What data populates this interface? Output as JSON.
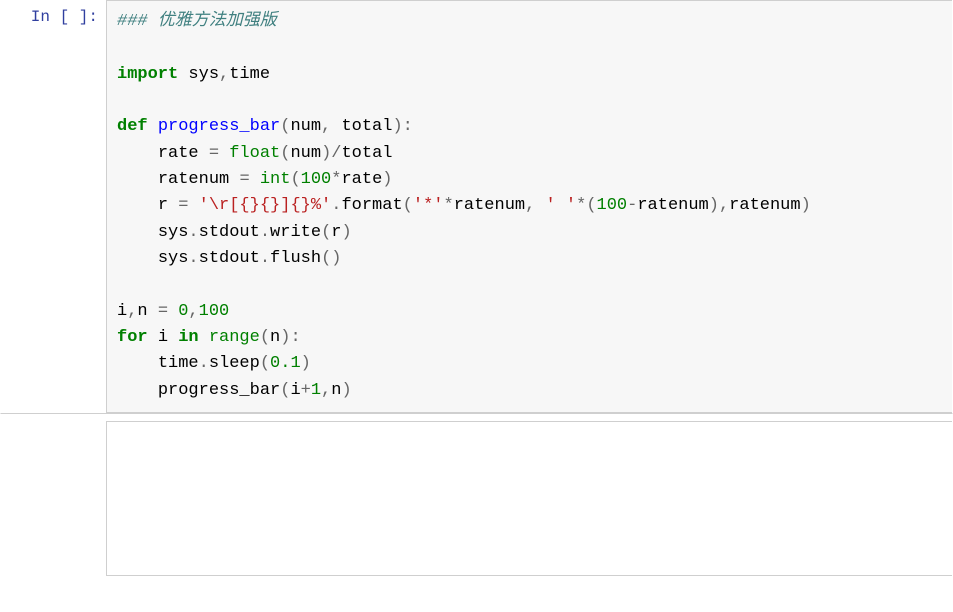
{
  "cell1": {
    "prompt": "In [ ]:",
    "code": {
      "comment": "### 优雅方法加强版",
      "kw_import": "import",
      "mod_sys": "sys",
      "mod_time": "time",
      "kw_def": "def",
      "fn_progress_bar": "progress_bar",
      "param_num": "num",
      "param_total": "total",
      "var_rate": "rate",
      "builtin_float": "float",
      "var_ratenum": "ratenum",
      "builtin_int": "int",
      "num_100a": "100",
      "num_100b": "100",
      "var_r": "r",
      "str_fmt": "'\\r[{}{}]{}%'",
      "attr_format": "format",
      "str_star": "'*'",
      "str_space": "' '",
      "attr_stdout": "stdout",
      "attr_write": "write",
      "attr_flush": "flush",
      "var_i": "i",
      "var_n": "n",
      "num_0": "0",
      "num_100c": "100",
      "kw_for": "for",
      "kw_in": "in",
      "builtin_range": "range",
      "attr_sleep": "sleep",
      "num_0_1": "0.1",
      "num_1": "1",
      "op_eq": "=",
      "op_star": "*",
      "op_plus": "+",
      "op_minus": "-",
      "op_slash": "/",
      "p_comma": ",",
      "p_colon": ":",
      "p_dot": ".",
      "p_lparen": "(",
      "p_rparen": ")"
    }
  },
  "cell2": {
    "prompt": ""
  }
}
